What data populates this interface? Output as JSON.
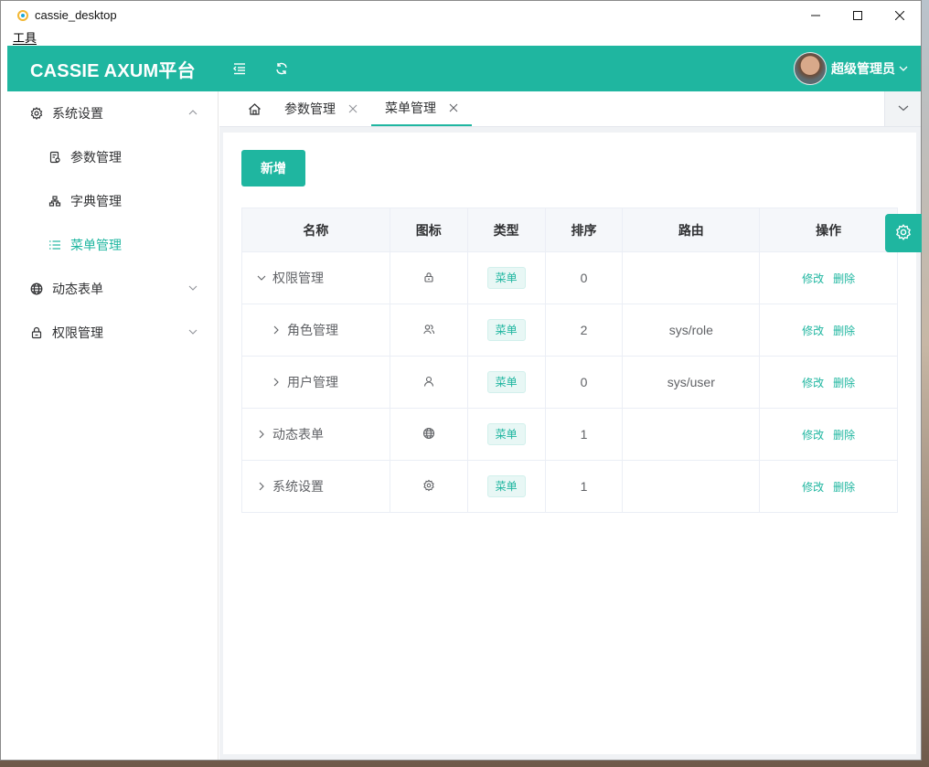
{
  "window": {
    "title": "cassie_desktop",
    "menu": [
      "工具"
    ]
  },
  "header": {
    "brand": "CASSIE AXUM平台",
    "username": "超级管理员"
  },
  "sidebar": {
    "items": [
      {
        "label": "系统设置",
        "icon": "gear-icon",
        "expanded": true
      },
      {
        "label": "参数管理",
        "icon": "document-icon"
      },
      {
        "label": "字典管理",
        "icon": "hierarchy-icon"
      },
      {
        "label": "菜单管理",
        "icon": "list-icon",
        "active": true
      },
      {
        "label": "动态表单",
        "icon": "globe-icon"
      },
      {
        "label": "权限管理",
        "icon": "lock-icon"
      }
    ]
  },
  "tabs": [
    {
      "label": "参数管理"
    },
    {
      "label": "菜单管理",
      "active": true
    }
  ],
  "toolbar": {
    "add_label": "新增"
  },
  "table": {
    "headers": [
      "名称",
      "图标",
      "类型",
      "排序",
      "路由",
      "操作"
    ],
    "rows": [
      {
        "name": "权限管理",
        "icon": "lock-icon",
        "type": "菜单",
        "sort": "0",
        "route": "",
        "edit": "修改",
        "delete": "删除"
      },
      {
        "name": "角色管理",
        "icon": "users-icon",
        "type": "菜单",
        "sort": "2",
        "route": "sys/role",
        "edit": "修改",
        "delete": "删除"
      },
      {
        "name": "用户管理",
        "icon": "user-icon",
        "type": "菜单",
        "sort": "0",
        "route": "sys/user",
        "edit": "修改",
        "delete": "删除"
      },
      {
        "name": "动态表单",
        "icon": "globe-icon",
        "type": "菜单",
        "sort": "1",
        "route": "",
        "edit": "修改",
        "delete": "删除"
      },
      {
        "name": "系统设置",
        "icon": "gear-icon",
        "type": "菜单",
        "sort": "1",
        "route": "",
        "edit": "修改",
        "delete": "删除"
      }
    ]
  },
  "colors": {
    "accent": "#1fb6a0",
    "header_bg": "#1fb6a0"
  }
}
